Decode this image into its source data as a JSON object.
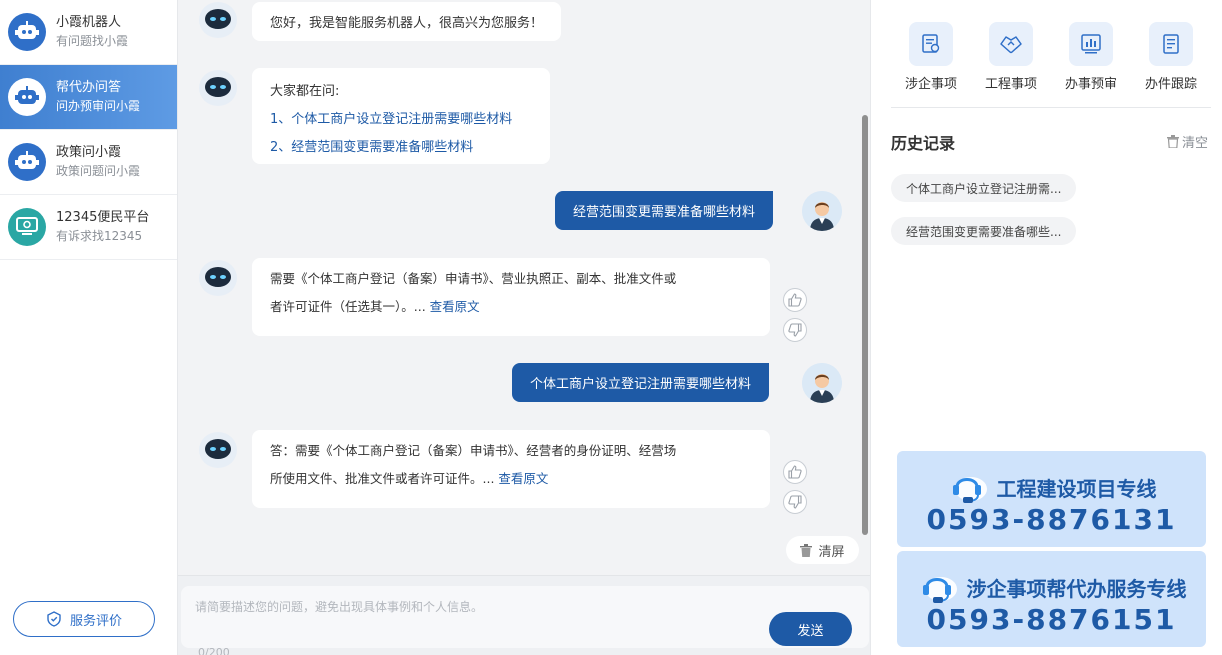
{
  "sidebar": {
    "items": [
      {
        "title": "小霞机器人",
        "sub": "有问题找小霞"
      },
      {
        "title": "帮代办问答",
        "sub": "问办预审问小霞"
      },
      {
        "title": "政策问小霞",
        "sub": "政策问题问小霞"
      },
      {
        "title": "12345便民平台",
        "sub": "有诉求找12345"
      }
    ],
    "eval_label": "服务评价"
  },
  "chat": {
    "greeting": "您好，我是智能服务机器人，很高兴为您服务！",
    "faq_title": "大家都在问:",
    "faq_items": [
      "1、个体工商户设立登记注册需要哪些材料",
      "2、经营范围变更需要准备哪些材料"
    ],
    "user_q1": "经营范围变更需要准备哪些材料",
    "answer1_line1": "需要《个体工商户登记（备案）申请书》、营业执照正、副本、批准文件或",
    "answer1_line2": "者许可证件（任选其一）。...",
    "view_original": "查看原文",
    "user_q2": "个体工商户设立登记注册需要哪些材料",
    "answer2_line1": "答：需要《个体工商户登记（备案）申请书》、经营者的身份证明、经营场",
    "answer2_line2": "所使用文件、批准文件或者许可证件。...",
    "clear_screen": "清屏"
  },
  "input": {
    "placeholder": "请简要描述您的问题，避免出现具体事例和个人信息。",
    "counter": "0/200",
    "send_label": "发送"
  },
  "right": {
    "shortcuts": [
      "涉企事项",
      "工程事项",
      "办事预审",
      "办件跟踪"
    ],
    "history_title": "历史记录",
    "history_clear": "清空",
    "history_items": [
      "个体工商户设立登记注册需...",
      "经营范围变更需要准备哪些..."
    ],
    "hotlines": [
      {
        "title": "工程建设项目专线",
        "number": "0593-8876131"
      },
      {
        "title": "涉企事项帮代办服务专线",
        "number": "0593-8876151"
      }
    ]
  },
  "colors": {
    "primary": "#1e5aa6",
    "accent": "#2f6fc8",
    "teal": "#2aa7a4",
    "chat_bg": "#f2f3f5",
    "hotline_bg": "#cfe3fb"
  }
}
